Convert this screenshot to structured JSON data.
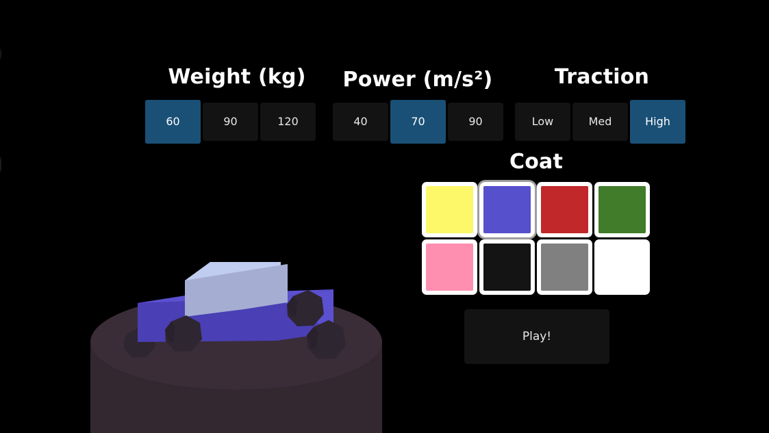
{
  "app": {
    "background_color": "#000000",
    "accent_selected": "#1b5076",
    "button_background": "#131313",
    "text_color": "#e8e8e8"
  },
  "groups": [
    {
      "id": "weight",
      "title": "Weight (kg)",
      "options": [
        {
          "label": "60",
          "selected": true
        },
        {
          "label": "90",
          "selected": false
        },
        {
          "label": "120",
          "selected": false
        }
      ]
    },
    {
      "id": "power",
      "title": "Power (m/s²)",
      "options": [
        {
          "label": "40",
          "selected": false
        },
        {
          "label": "70",
          "selected": true
        },
        {
          "label": "90",
          "selected": false
        }
      ]
    },
    {
      "id": "traction",
      "title": "Traction",
      "options": [
        {
          "label": "Low",
          "selected": false
        },
        {
          "label": "Med",
          "selected": false
        },
        {
          "label": "High",
          "selected": true
        }
      ]
    }
  ],
  "coat": {
    "title": "Coat",
    "swatches": [
      {
        "name": "yellow",
        "color": "#fdf76a",
        "selected": false
      },
      {
        "name": "blue",
        "color": "#5650cc",
        "selected": true
      },
      {
        "name": "red",
        "color": "#c0282a",
        "selected": false
      },
      {
        "name": "green",
        "color": "#407c2a",
        "selected": false
      },
      {
        "name": "pink",
        "color": "#ff8fb0",
        "selected": false
      },
      {
        "name": "black",
        "color": "#141414",
        "selected": false
      },
      {
        "name": "gray",
        "color": "#808080",
        "selected": false
      },
      {
        "name": "white",
        "color": "#ffffff",
        "selected": false
      }
    ]
  },
  "play": {
    "label": "Play!"
  },
  "preview": {
    "description": "3D low-poly truck on a round dark pedestal",
    "body_top_color": "#5b50d0",
    "body_side_color": "#4a3fb5",
    "body_front_color": "#3f35a0",
    "cabin_top_color": "#c0cdf0",
    "cabin_side_color": "#a5aed2",
    "cabin_front_color": "#b4bcdd",
    "wheel_color": "#2e2630",
    "wheel_shadow_color": "#241d26",
    "platform_top_color": "#3a2d38",
    "platform_side_color": "#332730"
  }
}
